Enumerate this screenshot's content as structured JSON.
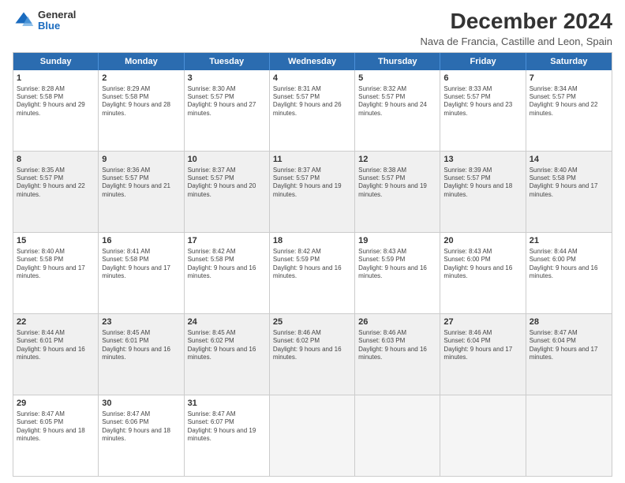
{
  "logo": {
    "general": "General",
    "blue": "Blue"
  },
  "title": "December 2024",
  "location": "Nava de Francia, Castille and Leon, Spain",
  "days": [
    "Sunday",
    "Monday",
    "Tuesday",
    "Wednesday",
    "Thursday",
    "Friday",
    "Saturday"
  ],
  "rows": [
    [
      {
        "day": "1",
        "sunrise": "Sunrise: 8:28 AM",
        "sunset": "Sunset: 5:58 PM",
        "daylight": "Daylight: 9 hours and 29 minutes.",
        "shade": false
      },
      {
        "day": "2",
        "sunrise": "Sunrise: 8:29 AM",
        "sunset": "Sunset: 5:58 PM",
        "daylight": "Daylight: 9 hours and 28 minutes.",
        "shade": false
      },
      {
        "day": "3",
        "sunrise": "Sunrise: 8:30 AM",
        "sunset": "Sunset: 5:57 PM",
        "daylight": "Daylight: 9 hours and 27 minutes.",
        "shade": false
      },
      {
        "day": "4",
        "sunrise": "Sunrise: 8:31 AM",
        "sunset": "Sunset: 5:57 PM",
        "daylight": "Daylight: 9 hours and 26 minutes.",
        "shade": false
      },
      {
        "day": "5",
        "sunrise": "Sunrise: 8:32 AM",
        "sunset": "Sunset: 5:57 PM",
        "daylight": "Daylight: 9 hours and 24 minutes.",
        "shade": false
      },
      {
        "day": "6",
        "sunrise": "Sunrise: 8:33 AM",
        "sunset": "Sunset: 5:57 PM",
        "daylight": "Daylight: 9 hours and 23 minutes.",
        "shade": false
      },
      {
        "day": "7",
        "sunrise": "Sunrise: 8:34 AM",
        "sunset": "Sunset: 5:57 PM",
        "daylight": "Daylight: 9 hours and 22 minutes.",
        "shade": false
      }
    ],
    [
      {
        "day": "8",
        "sunrise": "Sunrise: 8:35 AM",
        "sunset": "Sunset: 5:57 PM",
        "daylight": "Daylight: 9 hours and 22 minutes.",
        "shade": true
      },
      {
        "day": "9",
        "sunrise": "Sunrise: 8:36 AM",
        "sunset": "Sunset: 5:57 PM",
        "daylight": "Daylight: 9 hours and 21 minutes.",
        "shade": true
      },
      {
        "day": "10",
        "sunrise": "Sunrise: 8:37 AM",
        "sunset": "Sunset: 5:57 PM",
        "daylight": "Daylight: 9 hours and 20 minutes.",
        "shade": true
      },
      {
        "day": "11",
        "sunrise": "Sunrise: 8:37 AM",
        "sunset": "Sunset: 5:57 PM",
        "daylight": "Daylight: 9 hours and 19 minutes.",
        "shade": true
      },
      {
        "day": "12",
        "sunrise": "Sunrise: 8:38 AM",
        "sunset": "Sunset: 5:57 PM",
        "daylight": "Daylight: 9 hours and 19 minutes.",
        "shade": true
      },
      {
        "day": "13",
        "sunrise": "Sunrise: 8:39 AM",
        "sunset": "Sunset: 5:57 PM",
        "daylight": "Daylight: 9 hours and 18 minutes.",
        "shade": true
      },
      {
        "day": "14",
        "sunrise": "Sunrise: 8:40 AM",
        "sunset": "Sunset: 5:58 PM",
        "daylight": "Daylight: 9 hours and 17 minutes.",
        "shade": true
      }
    ],
    [
      {
        "day": "15",
        "sunrise": "Sunrise: 8:40 AM",
        "sunset": "Sunset: 5:58 PM",
        "daylight": "Daylight: 9 hours and 17 minutes.",
        "shade": false
      },
      {
        "day": "16",
        "sunrise": "Sunrise: 8:41 AM",
        "sunset": "Sunset: 5:58 PM",
        "daylight": "Daylight: 9 hours and 17 minutes.",
        "shade": false
      },
      {
        "day": "17",
        "sunrise": "Sunrise: 8:42 AM",
        "sunset": "Sunset: 5:58 PM",
        "daylight": "Daylight: 9 hours and 16 minutes.",
        "shade": false
      },
      {
        "day": "18",
        "sunrise": "Sunrise: 8:42 AM",
        "sunset": "Sunset: 5:59 PM",
        "daylight": "Daylight: 9 hours and 16 minutes.",
        "shade": false
      },
      {
        "day": "19",
        "sunrise": "Sunrise: 8:43 AM",
        "sunset": "Sunset: 5:59 PM",
        "daylight": "Daylight: 9 hours and 16 minutes.",
        "shade": false
      },
      {
        "day": "20",
        "sunrise": "Sunrise: 8:43 AM",
        "sunset": "Sunset: 6:00 PM",
        "daylight": "Daylight: 9 hours and 16 minutes.",
        "shade": false
      },
      {
        "day": "21",
        "sunrise": "Sunrise: 8:44 AM",
        "sunset": "Sunset: 6:00 PM",
        "daylight": "Daylight: 9 hours and 16 minutes.",
        "shade": false
      }
    ],
    [
      {
        "day": "22",
        "sunrise": "Sunrise: 8:44 AM",
        "sunset": "Sunset: 6:01 PM",
        "daylight": "Daylight: 9 hours and 16 minutes.",
        "shade": true
      },
      {
        "day": "23",
        "sunrise": "Sunrise: 8:45 AM",
        "sunset": "Sunset: 6:01 PM",
        "daylight": "Daylight: 9 hours and 16 minutes.",
        "shade": true
      },
      {
        "day": "24",
        "sunrise": "Sunrise: 8:45 AM",
        "sunset": "Sunset: 6:02 PM",
        "daylight": "Daylight: 9 hours and 16 minutes.",
        "shade": true
      },
      {
        "day": "25",
        "sunrise": "Sunrise: 8:46 AM",
        "sunset": "Sunset: 6:02 PM",
        "daylight": "Daylight: 9 hours and 16 minutes.",
        "shade": true
      },
      {
        "day": "26",
        "sunrise": "Sunrise: 8:46 AM",
        "sunset": "Sunset: 6:03 PM",
        "daylight": "Daylight: 9 hours and 16 minutes.",
        "shade": true
      },
      {
        "day": "27",
        "sunrise": "Sunrise: 8:46 AM",
        "sunset": "Sunset: 6:04 PM",
        "daylight": "Daylight: 9 hours and 17 minutes.",
        "shade": true
      },
      {
        "day": "28",
        "sunrise": "Sunrise: 8:47 AM",
        "sunset": "Sunset: 6:04 PM",
        "daylight": "Daylight: 9 hours and 17 minutes.",
        "shade": true
      }
    ],
    [
      {
        "day": "29",
        "sunrise": "Sunrise: 8:47 AM",
        "sunset": "Sunset: 6:05 PM",
        "daylight": "Daylight: 9 hours and 18 minutes.",
        "shade": false
      },
      {
        "day": "30",
        "sunrise": "Sunrise: 8:47 AM",
        "sunset": "Sunset: 6:06 PM",
        "daylight": "Daylight: 9 hours and 18 minutes.",
        "shade": false
      },
      {
        "day": "31",
        "sunrise": "Sunrise: 8:47 AM",
        "sunset": "Sunset: 6:07 PM",
        "daylight": "Daylight: 9 hours and 19 minutes.",
        "shade": false
      },
      {
        "day": "",
        "sunrise": "",
        "sunset": "",
        "daylight": "",
        "shade": true,
        "empty": true
      },
      {
        "day": "",
        "sunrise": "",
        "sunset": "",
        "daylight": "",
        "shade": true,
        "empty": true
      },
      {
        "day": "",
        "sunrise": "",
        "sunset": "",
        "daylight": "",
        "shade": true,
        "empty": true
      },
      {
        "day": "",
        "sunrise": "",
        "sunset": "",
        "daylight": "",
        "shade": true,
        "empty": true
      }
    ]
  ]
}
